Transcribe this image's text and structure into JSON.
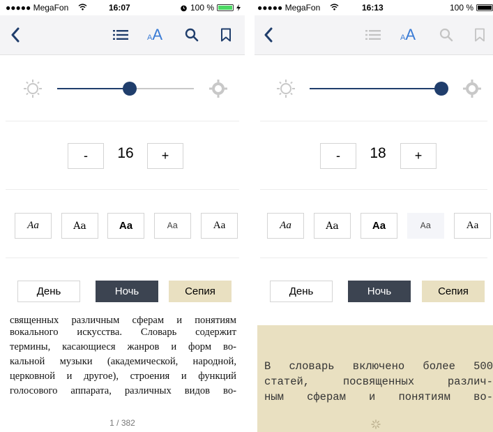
{
  "left": {
    "status": {
      "carrier": "●●●●● MegaFon",
      "time": "16:07",
      "battery_pct": "100 %",
      "alarm_icon": "alarm-clock-icon"
    },
    "toolbar": {
      "back_icon": "chevron-left-icon",
      "toc_icon": "list-icon",
      "font_icon": "font-size-icon",
      "font_label": "AA",
      "search_icon": "search-icon",
      "bookmark_icon": "bookmark-icon"
    },
    "brightness": {
      "value": 0.53
    },
    "font_size": {
      "minus": "-",
      "value": "16",
      "plus": "+"
    },
    "fonts": [
      "Aa",
      "Aa",
      "Aa",
      "Aa",
      "Aa"
    ],
    "themes": {
      "day": "День",
      "night": "Ночь",
      "sepia": "Сепия"
    },
    "reader": {
      "cut_line": "священных различным сферам и понятиям",
      "lines": [
        "вокального искусства. Словарь содержит",
        "термины, касающиеся жанров и форм во-",
        "кальной музыки (академической, народной,",
        "церковной и другое), строения и функций",
        "голосового аппарата, различных видов во-"
      ],
      "pager": "1 / 382"
    }
  },
  "right": {
    "status": {
      "carrier": "●●●●● MegaFon",
      "time": "16:13",
      "battery_pct": "100 %"
    },
    "toolbar": {
      "back_icon": "chevron-left-icon",
      "toc_icon": "list-icon",
      "font_icon": "font-size-icon",
      "font_label": "AA",
      "search_icon": "search-icon",
      "bookmark_icon": "bookmark-icon"
    },
    "brightness": {
      "value": 1.0
    },
    "font_size": {
      "minus": "-",
      "value": "18",
      "plus": "+"
    },
    "fonts": [
      "Aa",
      "Aa",
      "Aa",
      "Aa",
      "Aa"
    ],
    "themes": {
      "day": "День",
      "night": "Ночь",
      "sepia": "Сепия"
    },
    "reader": {
      "lines": [
        "В словарь включено более 500",
        "статей, посвященных различ-",
        "ным сферам и понятиям во-"
      ]
    }
  },
  "colors": {
    "accent": "#203e6c",
    "night": "#3c4451",
    "sepia": "#e9e0c1",
    "toolbar_bg": "#f4f4f6"
  }
}
